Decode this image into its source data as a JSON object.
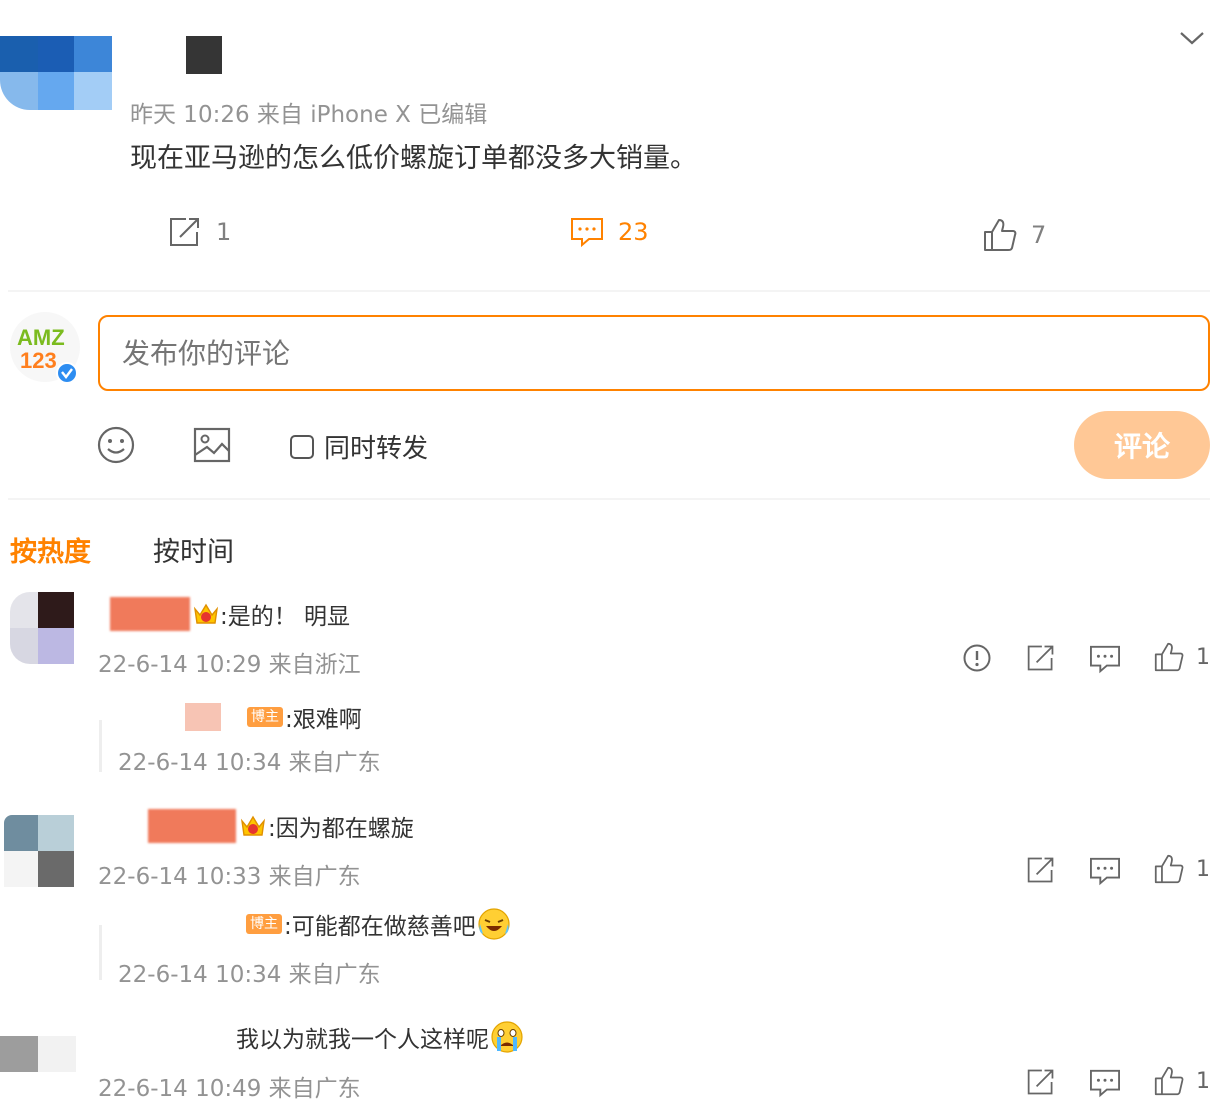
{
  "post": {
    "meta": "昨天 10:26 来自 iPhone X 已编辑",
    "text": "现在亚马逊的怎么低价螺旋订单都没多大销量。",
    "repost_count": "1",
    "comment_count": "23",
    "like_count": "7"
  },
  "composer": {
    "avatar_line1": "AMZ",
    "avatar_line2": "123",
    "placeholder": "发布你的评论",
    "also_repost_label": "同时转发",
    "submit_label": "评论"
  },
  "sort_tabs": {
    "hot": "按热度",
    "time": "按时间"
  },
  "comments": [
    {
      "text": ":是的！ 明显",
      "meta": "22-6-14 10:29 来自浙江",
      "like_count": "1",
      "reply": {
        "badge": "博主",
        "text": ":艰难啊",
        "meta": "22-6-14 10:34 来自广东"
      }
    },
    {
      "text": ":因为都在螺旋",
      "meta": "22-6-14 10:33 来自广东",
      "like_count": "1",
      "reply": {
        "badge": "博主",
        "text": ":可能都在做慈善吧",
        "meta": "22-6-14 10:34 来自广东"
      }
    },
    {
      "text": "我以为就我一个人这样呢",
      "meta": "22-6-14 10:49 来自广东",
      "like_count": "1"
    }
  ],
  "colors": {
    "accent": "#ff8200",
    "submit_bg": "#ffc896",
    "meta": "#939393"
  },
  "icons": [
    "chevron-down-icon",
    "repost-icon",
    "comment-icon",
    "like-icon",
    "emoji-icon",
    "image-icon",
    "report-icon",
    "verified-icon",
    "crown-icon",
    "laugh-cry-emoji",
    "crying-emoji"
  ]
}
